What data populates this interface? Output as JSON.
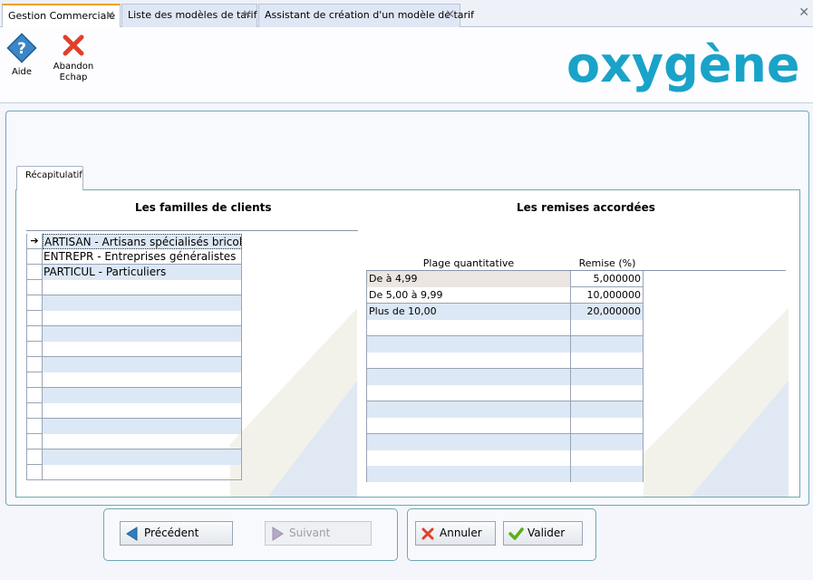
{
  "tabs": [
    {
      "label": "Gestion Commerciale",
      "active": true
    },
    {
      "label": "Liste des modèles de tarif",
      "active": false
    },
    {
      "label": "Assistant de création d'un modèle de tarif",
      "active": false
    }
  ],
  "close_glyph": "✕",
  "toolbar": {
    "help_label": "Aide",
    "abandon_label_line1": "Abandon",
    "abandon_label_line2": "Echap"
  },
  "logo": {
    "text": "oxygène",
    "color": "#1aa3c8"
  },
  "section_tab": "Récapitulatif",
  "families": {
    "title": "Les familles de clients",
    "current_marker": "➔",
    "rows": [
      "ARTISAN - Artisans spécialisés bricolag",
      "ENTREPR - Entreprises généralistes",
      "PARTICUL - Particuliers"
    ]
  },
  "discounts": {
    "title": "Les remises accordées",
    "col_range": "Plage quantitative",
    "col_discount": "Remise (%)",
    "rows": [
      {
        "range": "De  à 4,99",
        "discount": "5,000000"
      },
      {
        "range": "De 5,00 à 9,99",
        "discount": "10,000000"
      },
      {
        "range": "Plus de 10,00",
        "discount": "20,000000"
      }
    ]
  },
  "nav": {
    "previous": "Précédent",
    "next": "Suivant",
    "cancel": "Annuler",
    "validate": "Valider"
  },
  "colors": {
    "accent_tab": "#f0a030",
    "panel_border": "#6fa7b7",
    "row_alt": "#dde8f6",
    "cancel_red": "#e0402a",
    "validate_green": "#5aae1e",
    "nav_blue": "#2f7fc0"
  }
}
